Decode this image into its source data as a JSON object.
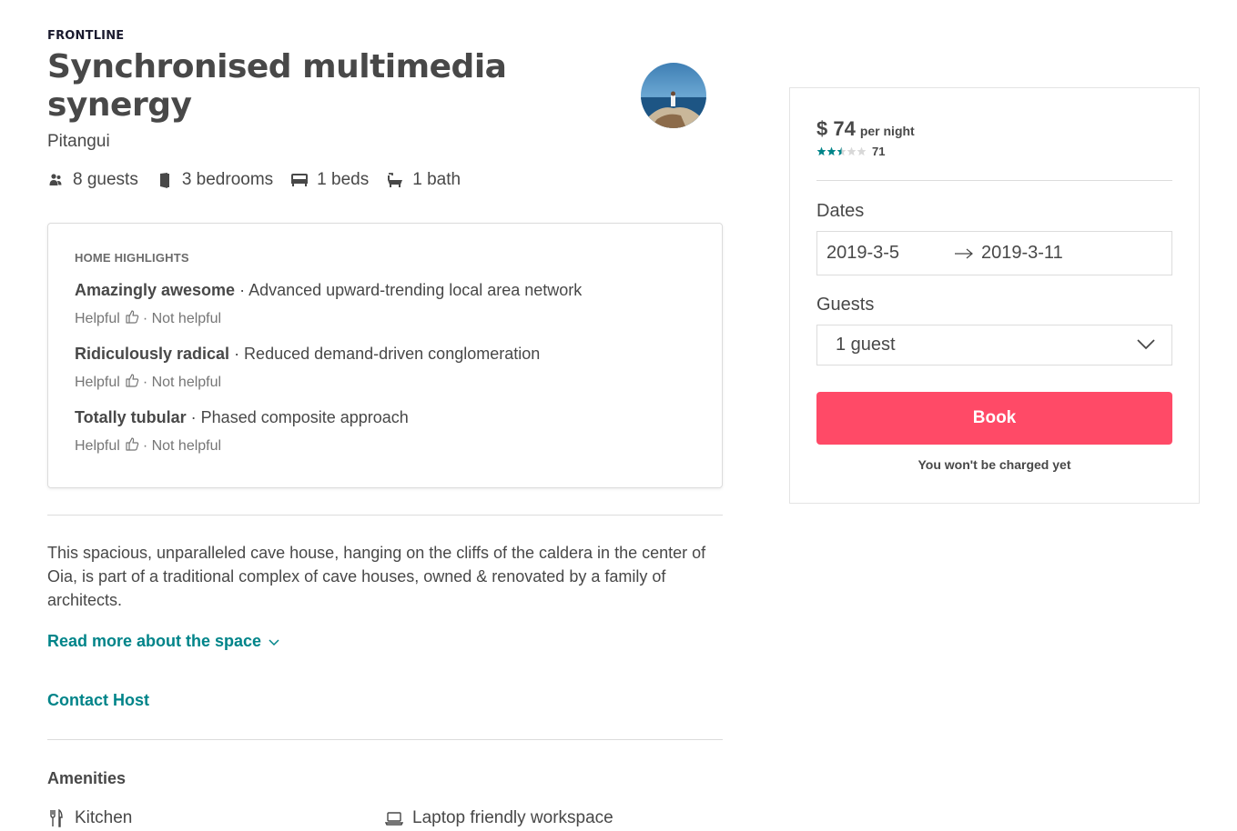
{
  "listing": {
    "brand": "FRONTLINE",
    "title": "Synchronised multimedia synergy",
    "location": "Pitangui"
  },
  "facts": [
    {
      "icon": "guests-icon",
      "label": "8 guests"
    },
    {
      "icon": "door-icon",
      "label": "3 bedrooms"
    },
    {
      "icon": "bed-icon",
      "label": "1 beds"
    },
    {
      "icon": "bath-icon",
      "label": "1 bath"
    }
  ],
  "highlights": {
    "heading": "HOME HIGHLIGHTS",
    "items": [
      {
        "name": "Amazingly awesome",
        "text": " · Advanced upward-trending local area network",
        "helpful": "Helpful",
        "not_helpful": " · Not helpful"
      },
      {
        "name": "Ridiculously radical",
        "text": " · Reduced demand-driven conglomeration",
        "helpful": "Helpful",
        "not_helpful": " · Not helpful"
      },
      {
        "name": "Totally tubular",
        "text": " · Phased composite approach",
        "helpful": "Helpful",
        "not_helpful": " · Not helpful"
      }
    ]
  },
  "description": {
    "text": "This spacious, unparalleled cave house, hanging on the cliffs of the caldera in the center of Oia, is part of a traditional complex of cave houses, owned & renovated by a family of architects.",
    "read_more": "Read more about the space",
    "contact": "Contact Host"
  },
  "amenities": {
    "title": "Amenities",
    "items": [
      {
        "icon": "kitchen-icon",
        "label": "Kitchen"
      },
      {
        "icon": "laptop-icon",
        "label": "Laptop friendly workspace"
      }
    ]
  },
  "booking": {
    "price": "$ 74",
    "per_night": "per night",
    "rating": 2.5,
    "rating_max": 5,
    "review_count": "71",
    "dates_label": "Dates",
    "check_in": "2019-3-5",
    "check_out": "2019-3-11",
    "guests_label": "Guests",
    "guests_value": "1 guest",
    "book_label": "Book",
    "note": "You won't be charged yet"
  },
  "colors": {
    "accent": "#008489",
    "book": "#ff4a67",
    "text": "#484848"
  }
}
